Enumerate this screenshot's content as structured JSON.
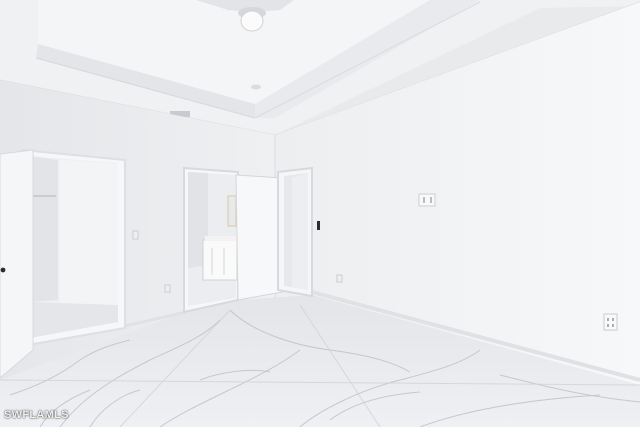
{
  "photo": {
    "watermark_text": "SWFLAMLS",
    "colors": {
      "wall_right": "#f3f4f5",
      "wall_left": "#e9eaec",
      "ceiling": "#f1f2f3",
      "floor": "#e6e7ea",
      "marble_vein": "#b9bcc2"
    }
  }
}
